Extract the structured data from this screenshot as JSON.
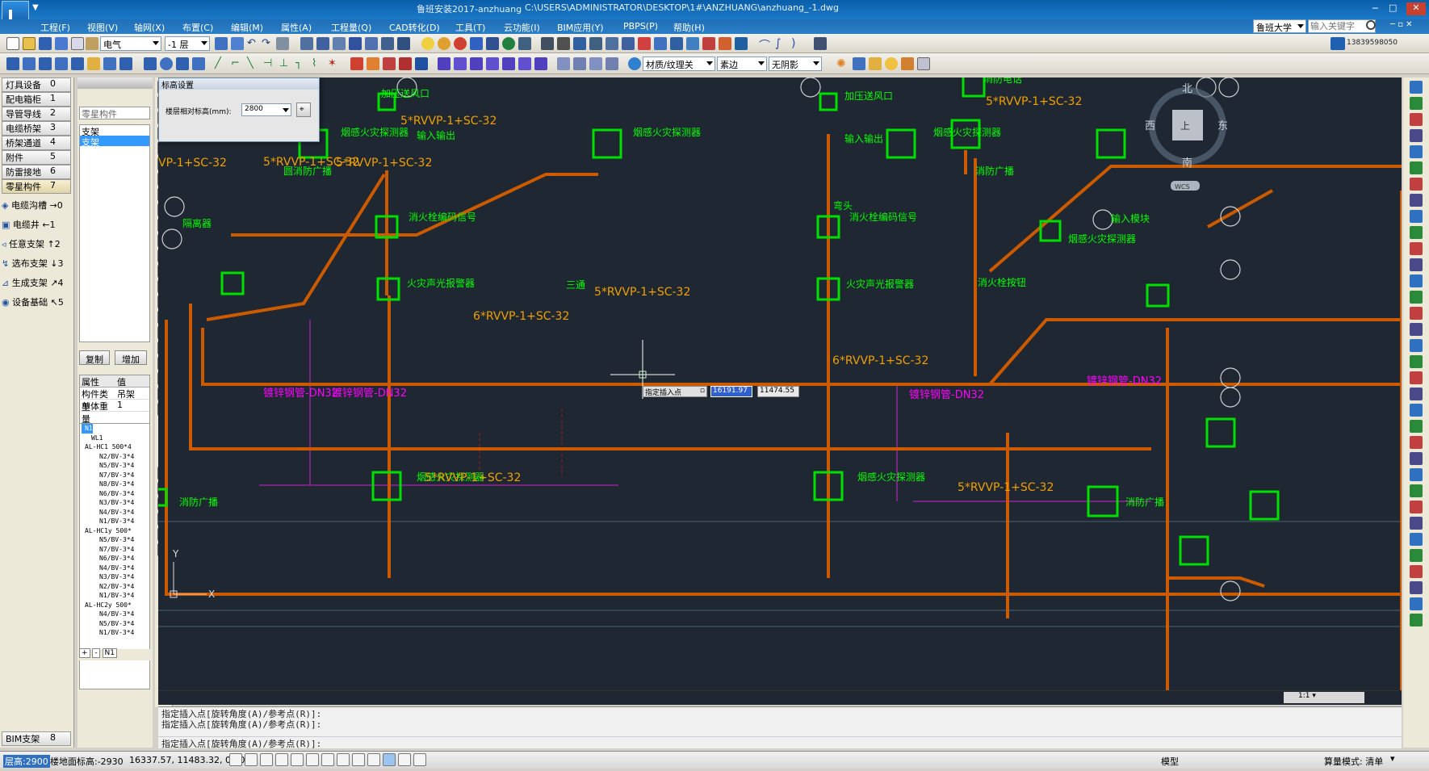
{
  "title_bar": {
    "app_title": "鲁班安装2017-anzhuang",
    "file_path": "C:\\USERS\\ADMINISTRATOR\\DESKTOP\\1#\\ANZHUANG\\anzhuang_-1.dwg"
  },
  "menu": [
    "工程(F)",
    "视图(V)",
    "轴网(X)",
    "布置(C)",
    "编辑(M)",
    "属性(A)",
    "工程量(Q)",
    "CAD转化(D)",
    "工具(T)",
    "云功能(I)",
    "BIM应用(Y)",
    "PBPS(P)",
    "帮助(H)"
  ],
  "search": {
    "scope": "鲁班大学",
    "placeholder": "输入关键字"
  },
  "account": {
    "phone": "13839598050"
  },
  "toolbar": {
    "discipline": "电气",
    "floor": "-1 层",
    "material": "材质/纹理关",
    "edge": "素边",
    "shadow": "无阴影"
  },
  "left_nav": {
    "items": [
      {
        "label": "灯具设备",
        "count": "0"
      },
      {
        "label": "配电箱柜",
        "count": "1"
      },
      {
        "label": "导管导线",
        "count": "2"
      },
      {
        "label": "电缆桥架",
        "count": "3"
      },
      {
        "label": "桥架通道",
        "count": "4"
      },
      {
        "label": "附件",
        "count": "5"
      },
      {
        "label": "防雷接地",
        "count": "6"
      },
      {
        "label": "零星构件",
        "count": "7"
      }
    ],
    "tools": [
      {
        "label": "电缆沟槽",
        "key": "0"
      },
      {
        "label": "电缆井",
        "key": "1"
      },
      {
        "label": "任意支架",
        "key": "2"
      },
      {
        "label": "选布支架",
        "key": "3"
      },
      {
        "label": "生成支架",
        "key": "4"
      },
      {
        "label": "设备基础",
        "key": "5"
      }
    ],
    "bottom": {
      "label": "BIM支架",
      "count": "8"
    }
  },
  "mid_panel": {
    "category": "零星构件",
    "list": [
      "支架",
      "支架"
    ],
    "copy_btn": "复制",
    "add_btn": "增加",
    "props_header": [
      "属性",
      "值"
    ],
    "props": [
      {
        "name": "构件类型",
        "value": "吊架"
      },
      {
        "name": "单体重量",
        "value": "1"
      }
    ],
    "tree": [
      "N1",
      "WL1",
      "AL-HC1 500*4",
      "N2/BV-3*4",
      "N5/BV-3*4",
      "N7/BV-3*4",
      "N8/BV-3*4",
      "N6/BV-3*4",
      "N3/BV-3*4",
      "N4/BV-3*4",
      "N1/BV-3*4",
      "AL-HC1y 500*",
      "N5/BV-3*4",
      "N7/BV-3*4",
      "N6/BV-3*4",
      "N4/BV-3*4",
      "N3/BV-3*4",
      "N2/BV-3*4",
      "N1/BV-3*4",
      "AL-HC2y 500*",
      "N4/BV-3*4",
      "N5/BV-3*4",
      "N1/BV-3*4"
    ],
    "tree_footer": [
      "+",
      "-",
      "N1"
    ]
  },
  "elevation_dialog": {
    "title": "标高设置",
    "label": "楼层相对标高(mm):",
    "value": "2800"
  },
  "canvas": {
    "labels": [
      {
        "t": "加压送风口",
        "c": "#00ff00"
      },
      {
        "t": "5*RVVP-1+SC-32",
        "c": "#f0a000"
      },
      {
        "t": "烟感火灾探测器",
        "c": "#00ff00"
      },
      {
        "t": "输入输出",
        "c": "#00ff00"
      },
      {
        "t": "5*RVVP-1+SC-32",
        "c": "#f0a000"
      },
      {
        "t": "烟感火灾探测器",
        "c": "#00ff00"
      },
      {
        "t": "圆消防广播",
        "c": "#00ff00"
      },
      {
        "t": "VP-1+SC-32",
        "c": "#f0a000"
      },
      {
        "t": "5*RVVP-1+SC-32",
        "c": "#f0a000"
      },
      {
        "t": "消火栓编码信号",
        "c": "#00ff00"
      },
      {
        "t": "隔离器",
        "c": "#00ff00"
      },
      {
        "t": "火灾声光报警器",
        "c": "#00ff00"
      },
      {
        "t": "三通",
        "c": "#00ff00"
      },
      {
        "t": "5*RVVP-1+SC-32",
        "c": "#f0a000"
      },
      {
        "t": "6*RVVP-1+SC-32",
        "c": "#f0a000"
      },
      {
        "t": "镀锌钢管-DN32",
        "c": "#ff00ff"
      },
      {
        "t": "镀锌钢管-DN32",
        "c": "#ff00ff"
      },
      {
        "t": "烟感火灾探测器",
        "c": "#00ff00"
      },
      {
        "t": "5*RVVP-1+SC-32",
        "c": "#f0a000"
      },
      {
        "t": "消防广播",
        "c": "#00ff00"
      },
      {
        "t": "加压送风口",
        "c": "#00ff00"
      },
      {
        "t": "消防电话",
        "c": "#00ff00"
      },
      {
        "t": "5*RVVP-1+SC-32",
        "c": "#f0a000"
      },
      {
        "t": "输入输出",
        "c": "#00ff00"
      },
      {
        "t": "烟感火灾探测器",
        "c": "#00ff00"
      },
      {
        "t": "消防广播",
        "c": "#00ff00"
      },
      {
        "t": "消火栓编码信号",
        "c": "#00ff00"
      },
      {
        "t": "弯头",
        "c": "#00ff00"
      },
      {
        "t": "火灾声光报警器",
        "c": "#00ff00"
      },
      {
        "t": "输入模块",
        "c": "#00ff00"
      },
      {
        "t": "烟感火灾探测器",
        "c": "#00ff00"
      },
      {
        "t": "消火栓按钮",
        "c": "#00ff00"
      },
      {
        "t": "镀锌钢管-DN32",
        "c": "#ff00ff"
      },
      {
        "t": "6*RVVP-1+SC-32",
        "c": "#f0a000"
      },
      {
        "t": "镀锌钢管-DN32",
        "c": "#ff00ff"
      },
      {
        "t": "烟感火灾探测器",
        "c": "#00ff00"
      },
      {
        "t": "5*RVVP-1+SC-32",
        "c": "#f0a000"
      },
      {
        "t": "消防广播",
        "c": "#00ff00"
      }
    ],
    "compass": {
      "north": "北",
      "south": "南",
      "east": "东",
      "west": "西",
      "top": "上",
      "wcs": "WCS"
    },
    "axis": {
      "x": "X",
      "y": "Y"
    },
    "insert_prompt": {
      "label": "指定插入点",
      "x": "16191.97",
      "y": "11474.55"
    },
    "scale": "1:1"
  },
  "command_lines": [
    "指定插入点[旋转角度(A)/参考点(R)]:",
    "指定插入点[旋转角度(A)/参考点(R)]:",
    "指定插入点[旋转角度(A)/参考点(R)]:"
  ],
  "status": {
    "floor_height": "层高:2900",
    "ground_elev": "楼地面标高:-2930",
    "coords": "16337.57, 11483.32, 0.00",
    "model": "模型",
    "calc_mode": "算量模式: 清单"
  },
  "colors": {
    "canvas_bg": "#1f2732",
    "pipe": "#cc5a00",
    "symbol": "#00e000",
    "text": "#00ff00",
    "magenta": "#ff00ff"
  }
}
